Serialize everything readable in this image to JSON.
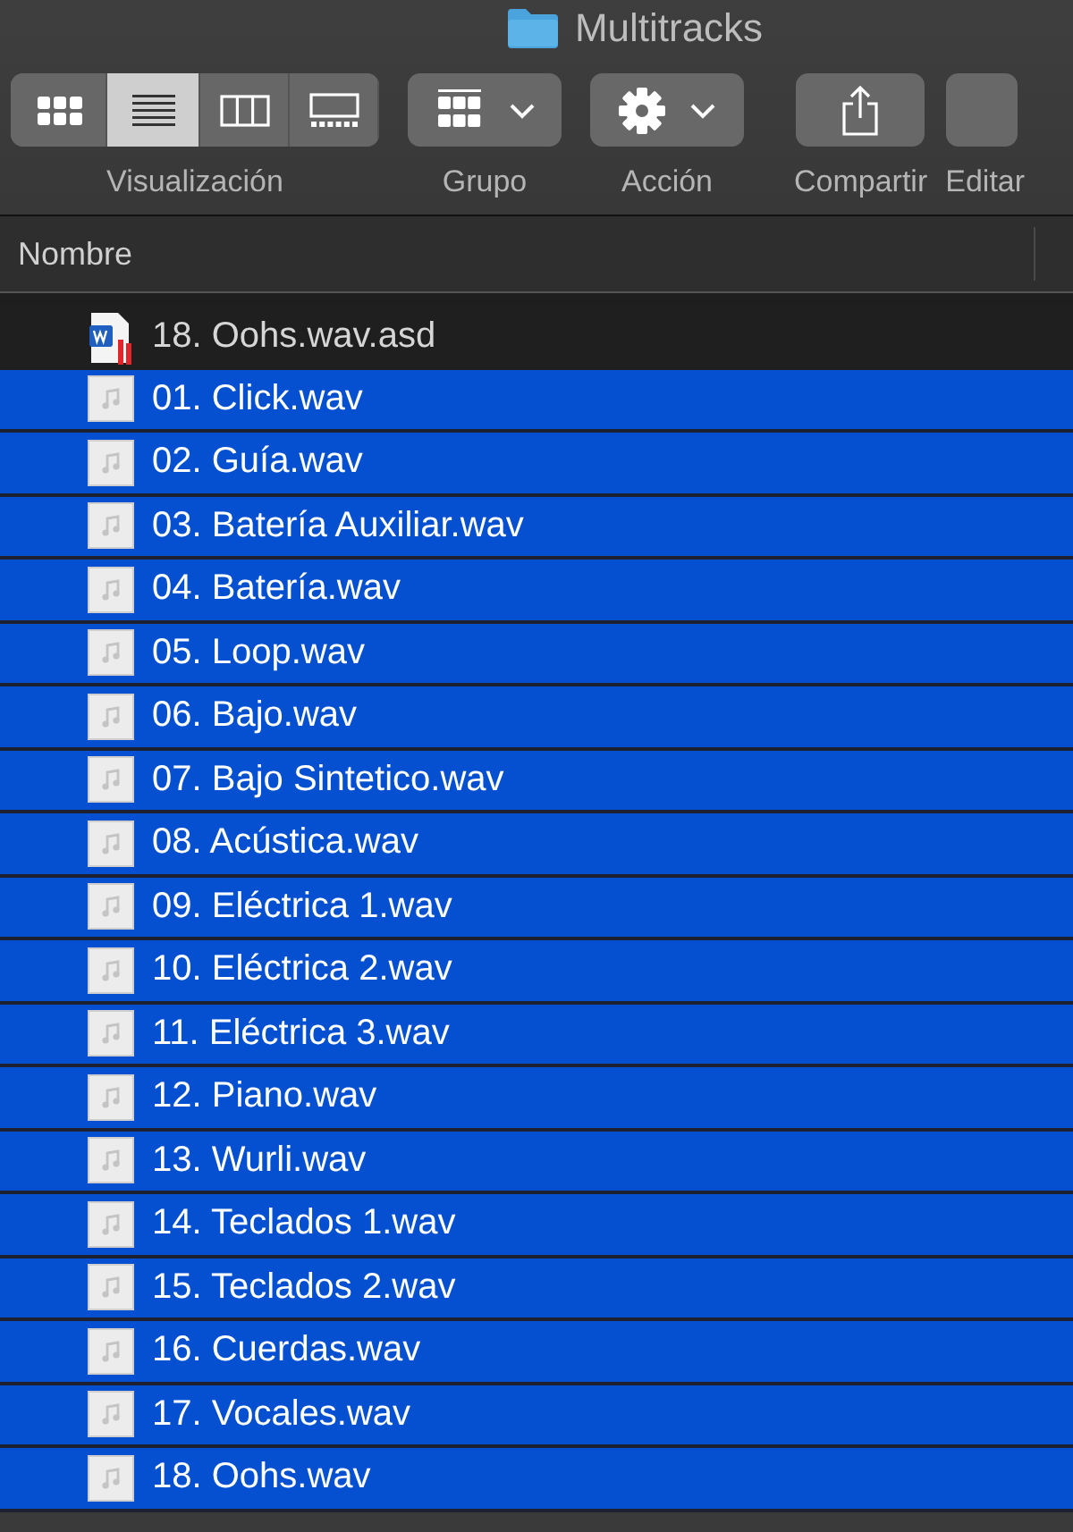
{
  "window": {
    "title": "Multitracks"
  },
  "toolbar": {
    "groups": [
      {
        "label": "Visualización",
        "kind": "segmented",
        "views": [
          {
            "selected": false
          },
          {
            "selected": true
          },
          {
            "selected": false
          },
          {
            "selected": false
          }
        ]
      },
      {
        "label": "Grupo",
        "kind": "menu"
      },
      {
        "label": "Acción",
        "kind": "menu"
      },
      {
        "label": "Compartir",
        "kind": "button"
      },
      {
        "label": "Editar",
        "kind": "button"
      }
    ]
  },
  "table": {
    "columns": [
      "Nombre"
    ],
    "rows": [
      {
        "name": "18. Oohs.wav.asd",
        "kind": "document",
        "selected": false
      },
      {
        "name": "01. Click.wav",
        "kind": "audio",
        "selected": true
      },
      {
        "name": "02. Guía.wav",
        "kind": "audio",
        "selected": true
      },
      {
        "name": "03. Batería Auxiliar.wav",
        "kind": "audio",
        "selected": true
      },
      {
        "name": "04. Batería.wav",
        "kind": "audio",
        "selected": true
      },
      {
        "name": "05. Loop.wav",
        "kind": "audio",
        "selected": true
      },
      {
        "name": "06. Bajo.wav",
        "kind": "audio",
        "selected": true
      },
      {
        "name": "07. Bajo Sintetico.wav",
        "kind": "audio",
        "selected": true
      },
      {
        "name": "08. Acústica.wav",
        "kind": "audio",
        "selected": true
      },
      {
        "name": "09. Eléctrica 1.wav",
        "kind": "audio",
        "selected": true
      },
      {
        "name": "10. Eléctrica 2.wav",
        "kind": "audio",
        "selected": true
      },
      {
        "name": "11. Eléctrica 3.wav",
        "kind": "audio",
        "selected": true
      },
      {
        "name": "12. Piano.wav",
        "kind": "audio",
        "selected": true
      },
      {
        "name": "13. Wurli.wav",
        "kind": "audio",
        "selected": true
      },
      {
        "name": "14. Teclados 1.wav",
        "kind": "audio",
        "selected": true
      },
      {
        "name": "15. Teclados 2.wav",
        "kind": "audio",
        "selected": true
      },
      {
        "name": "16. Cuerdas.wav",
        "kind": "audio",
        "selected": true
      },
      {
        "name": "17. Vocales.wav",
        "kind": "audio",
        "selected": true
      },
      {
        "name": "18. Oohs.wav",
        "kind": "audio",
        "selected": true
      }
    ]
  }
}
